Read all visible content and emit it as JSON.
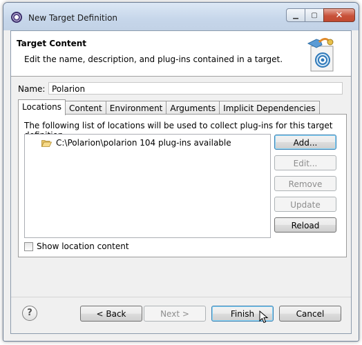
{
  "window": {
    "title": "New Target Definition",
    "caption_buttons": {
      "minimize": "▁",
      "maximize": "▢",
      "close": "✕"
    }
  },
  "header": {
    "title": "Target Content",
    "description": "Edit the name, description, and plug-ins contained in a target."
  },
  "name_field": {
    "label": "Name:",
    "value": "Polarion"
  },
  "tabs": [
    {
      "label": "Locations",
      "active": true
    },
    {
      "label": "Content",
      "active": false
    },
    {
      "label": "Environment",
      "active": false
    },
    {
      "label": "Arguments",
      "active": false
    },
    {
      "label": "Implicit Dependencies",
      "active": false
    }
  ],
  "locations_panel": {
    "description": "The following list of locations will be used to collect plug-ins for this target definition.",
    "locations": [
      {
        "text": "C:\\Polarion\\polarion 104 plug-ins available",
        "icon": "folder-open-icon"
      }
    ],
    "buttons": {
      "add": "Add...",
      "edit": "Edit...",
      "remove": "Remove",
      "update": "Update",
      "reload": "Reload"
    },
    "show_content_label": "Show location content",
    "show_content_checked": false
  },
  "footer": {
    "help_label": "?",
    "back": "< Back",
    "next": "Next >",
    "finish": "Finish",
    "cancel": "Cancel"
  },
  "colors": {
    "title_bar": "#c6d6ea",
    "close_button": "#c8523a",
    "dialog_bg": "#f0f0f0",
    "focus_border": "#3c7fb1"
  }
}
